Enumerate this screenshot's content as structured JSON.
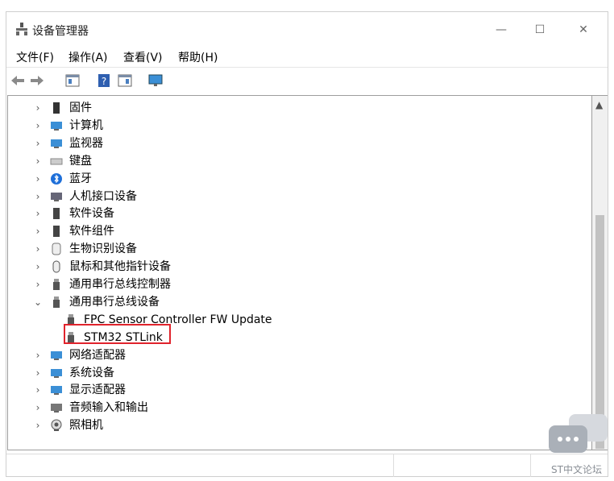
{
  "window": {
    "title": "设备管理器",
    "minimize": "—",
    "maximize": "☐",
    "close": "✕"
  },
  "menu": [
    "文件(F)",
    "操作(A)",
    "查看(V)",
    "帮助(H)"
  ],
  "toolbar": [
    "back-arrow-icon",
    "forward-arrow-icon",
    "properties-icon",
    "help-icon",
    "view-icon",
    "monitor-icon"
  ],
  "tree": [
    {
      "label": "固件",
      "icon": "firmware-icon",
      "expander": "›"
    },
    {
      "label": "计算机",
      "icon": "computer-icon",
      "expander": "›"
    },
    {
      "label": "监视器",
      "icon": "monitor-icon",
      "expander": "›"
    },
    {
      "label": "键盘",
      "icon": "keyboard-icon",
      "expander": "›"
    },
    {
      "label": "蓝牙",
      "icon": "bluetooth-icon",
      "expander": "›"
    },
    {
      "label": "人机接口设备",
      "icon": "hid-icon",
      "expander": "›"
    },
    {
      "label": "软件设备",
      "icon": "software-device-icon",
      "expander": "›"
    },
    {
      "label": "软件组件",
      "icon": "software-component-icon",
      "expander": "›"
    },
    {
      "label": "生物识别设备",
      "icon": "fingerprint-icon",
      "expander": "›"
    },
    {
      "label": "鼠标和其他指针设备",
      "icon": "mouse-icon",
      "expander": "›"
    },
    {
      "label": "通用串行总线控制器",
      "icon": "usb-icon",
      "expander": "›"
    },
    {
      "label": "通用串行总线设备",
      "icon": "usb-icon",
      "expander": "⌄"
    },
    {
      "label": "FPC Sensor Controller FW Update",
      "icon": "usb-icon",
      "child": true
    },
    {
      "label": "STM32 STLink",
      "icon": "usb-icon",
      "child": true
    },
    {
      "label": "网络适配器",
      "icon": "network-icon",
      "expander": "›"
    },
    {
      "label": "系统设备",
      "icon": "system-icon",
      "expander": "›"
    },
    {
      "label": "显示适配器",
      "icon": "display-adapter-icon",
      "expander": "›"
    },
    {
      "label": "音频输入和输出",
      "icon": "audio-icon",
      "expander": "›"
    },
    {
      "label": "照相机",
      "icon": "camera-icon",
      "expander": "›"
    }
  ],
  "watermark": {
    "text": "ST中文论坛"
  }
}
